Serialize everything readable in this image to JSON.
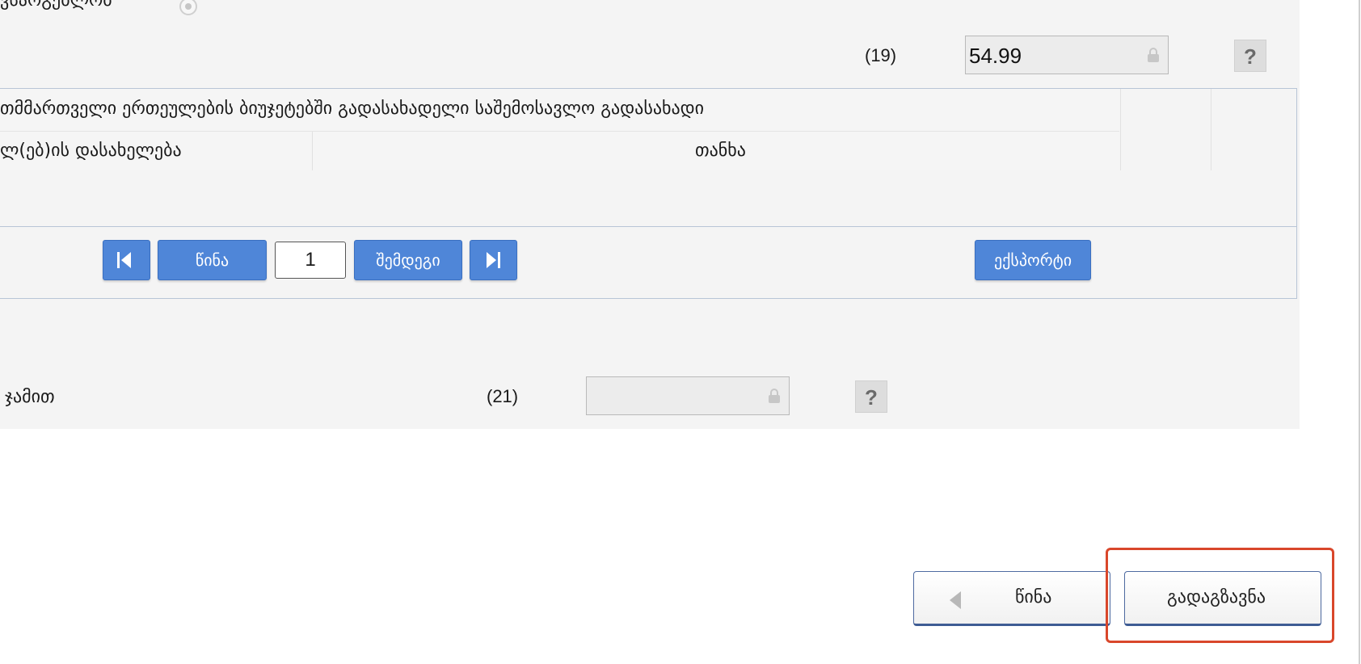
{
  "top": {
    "partial_label": "ვსაოგებლობ"
  },
  "field19": {
    "number": "(19)",
    "value": "54.99"
  },
  "table": {
    "title": "თმმართველი ერთეულების ბიუჯეტებში გადასახადელი საშემოსავლო გადასახადი",
    "col1": "ლ(ებ)ის დასახელება",
    "col2": "თანხა"
  },
  "pager": {
    "prev_label": "წინა",
    "page_value": "1",
    "next_label": "შემდეგი",
    "export_label": "ექსპორტი"
  },
  "total": {
    "label": "ჯამით",
    "number": "(21)",
    "value": ""
  },
  "footer": {
    "back_label": "წინა",
    "submit_label": "გადაგზავნა"
  },
  "colors": {
    "accent": "#4f86d8",
    "highlight": "#d9472b"
  }
}
